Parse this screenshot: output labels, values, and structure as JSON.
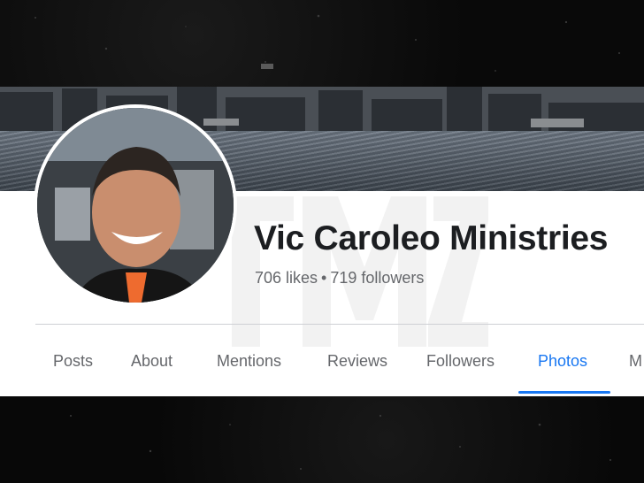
{
  "page": {
    "title": "Vic Caroleo Ministries",
    "likes": "706 likes",
    "separator": "•",
    "followers": "719 followers"
  },
  "tabs": [
    {
      "label": "Posts",
      "active": false
    },
    {
      "label": "About",
      "active": false
    },
    {
      "label": "Mentions",
      "active": false
    },
    {
      "label": "Reviews",
      "active": false
    },
    {
      "label": "Followers",
      "active": false
    },
    {
      "label": "Photos",
      "active": true
    },
    {
      "label": "M",
      "active": false
    }
  ],
  "watermark": "TMZ",
  "colors": {
    "accent": "#1877f2",
    "title": "#1c1e21",
    "secondary_text": "#65676b",
    "background": "#0b0b0b",
    "panel": "#ffffff"
  }
}
